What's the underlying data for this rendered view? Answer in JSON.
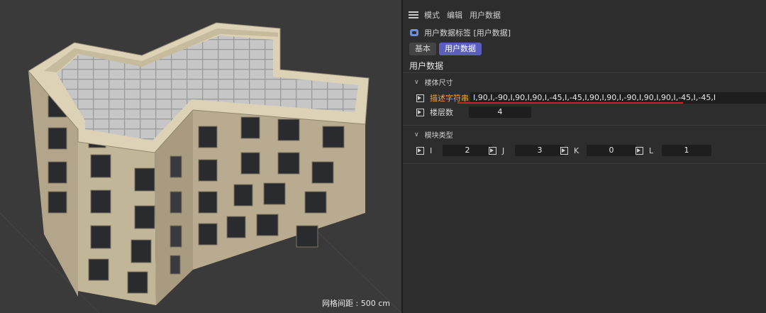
{
  "viewport": {
    "grid_readout": "网格间距 : 500 cm"
  },
  "panel": {
    "menu": [
      "模式",
      "编辑",
      "用户数据"
    ],
    "tag_title": "用户数据标签 [用户数据]",
    "tabs": [
      "基本",
      "用户数据"
    ],
    "active_tab": "用户数据",
    "section_title": "用户数据",
    "group1": {
      "title": "楼体尺寸",
      "desc_label": "描述字符串",
      "desc_value": "I,90,I,-90,I,90,I,90,I,-45,I,-45,I,90,I,90,I,-90,I,90,I,90,I,-45,I,-45,I",
      "floors_label": "楼层数",
      "floors_value": "4"
    },
    "group2": {
      "title": "模块类型",
      "fields": [
        {
          "label": "I",
          "value": "2"
        },
        {
          "label": "J",
          "value": "3"
        },
        {
          "label": "K",
          "value": "0"
        },
        {
          "label": "L",
          "value": "1"
        }
      ]
    }
  },
  "colors": {
    "accent_tab": "#5a5fbf",
    "label_highlight": "#f0a23a",
    "annotation_underline": "#d42020"
  }
}
